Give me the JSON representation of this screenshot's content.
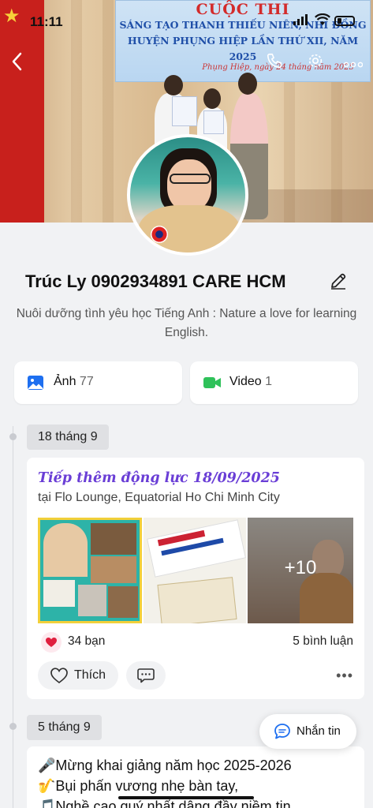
{
  "status_bar": {
    "time": "11:11"
  },
  "cover": {
    "banner_title": "CUỘC THI",
    "banner_line1": "SÁNG TẠO THANH THIẾU NIÊN, NHI ĐỒNG",
    "banner_line2": "HUYỆN PHỤNG HIỆP LẦN THỨ XII, NĂM 2025",
    "banner_foot": "Phụng Hiệp, ngày 24 tháng năm 2025"
  },
  "profile": {
    "name": "Trúc Ly 0902934891 CARE HCM",
    "bio": "Nuôi dưỡng tình yêu học Tiếng Anh : Nature a love for learning English."
  },
  "media": {
    "photos_label": "Ảnh",
    "photos_count": "77",
    "videos_label": "Video",
    "videos_count": "1"
  },
  "timeline": [
    {
      "date": "18 tháng 9",
      "title": "Tiếp thêm động lực 18/09/2025",
      "location": "tại Flo Lounge, Equatorial Ho Chi Minh City",
      "more_photos": "+10",
      "reactions": "34 bạn",
      "comments": "5 bình luận",
      "like_label": "Thích"
    },
    {
      "date": "5 tháng 9",
      "lines": [
        "🎤Mừng khai giảng năm học 2025-2026",
        "🎷Bụi phấn vương nhẹ bàn tay,",
        "🎵Nghề cao quý nhất dâng đầy niềm tin"
      ]
    }
  ],
  "message_button": {
    "label": "Nhắn tin"
  },
  "colors": {
    "accent": "#1e6ff0",
    "title_purple": "#6a3ed6",
    "video_green": "#2fc15a"
  }
}
